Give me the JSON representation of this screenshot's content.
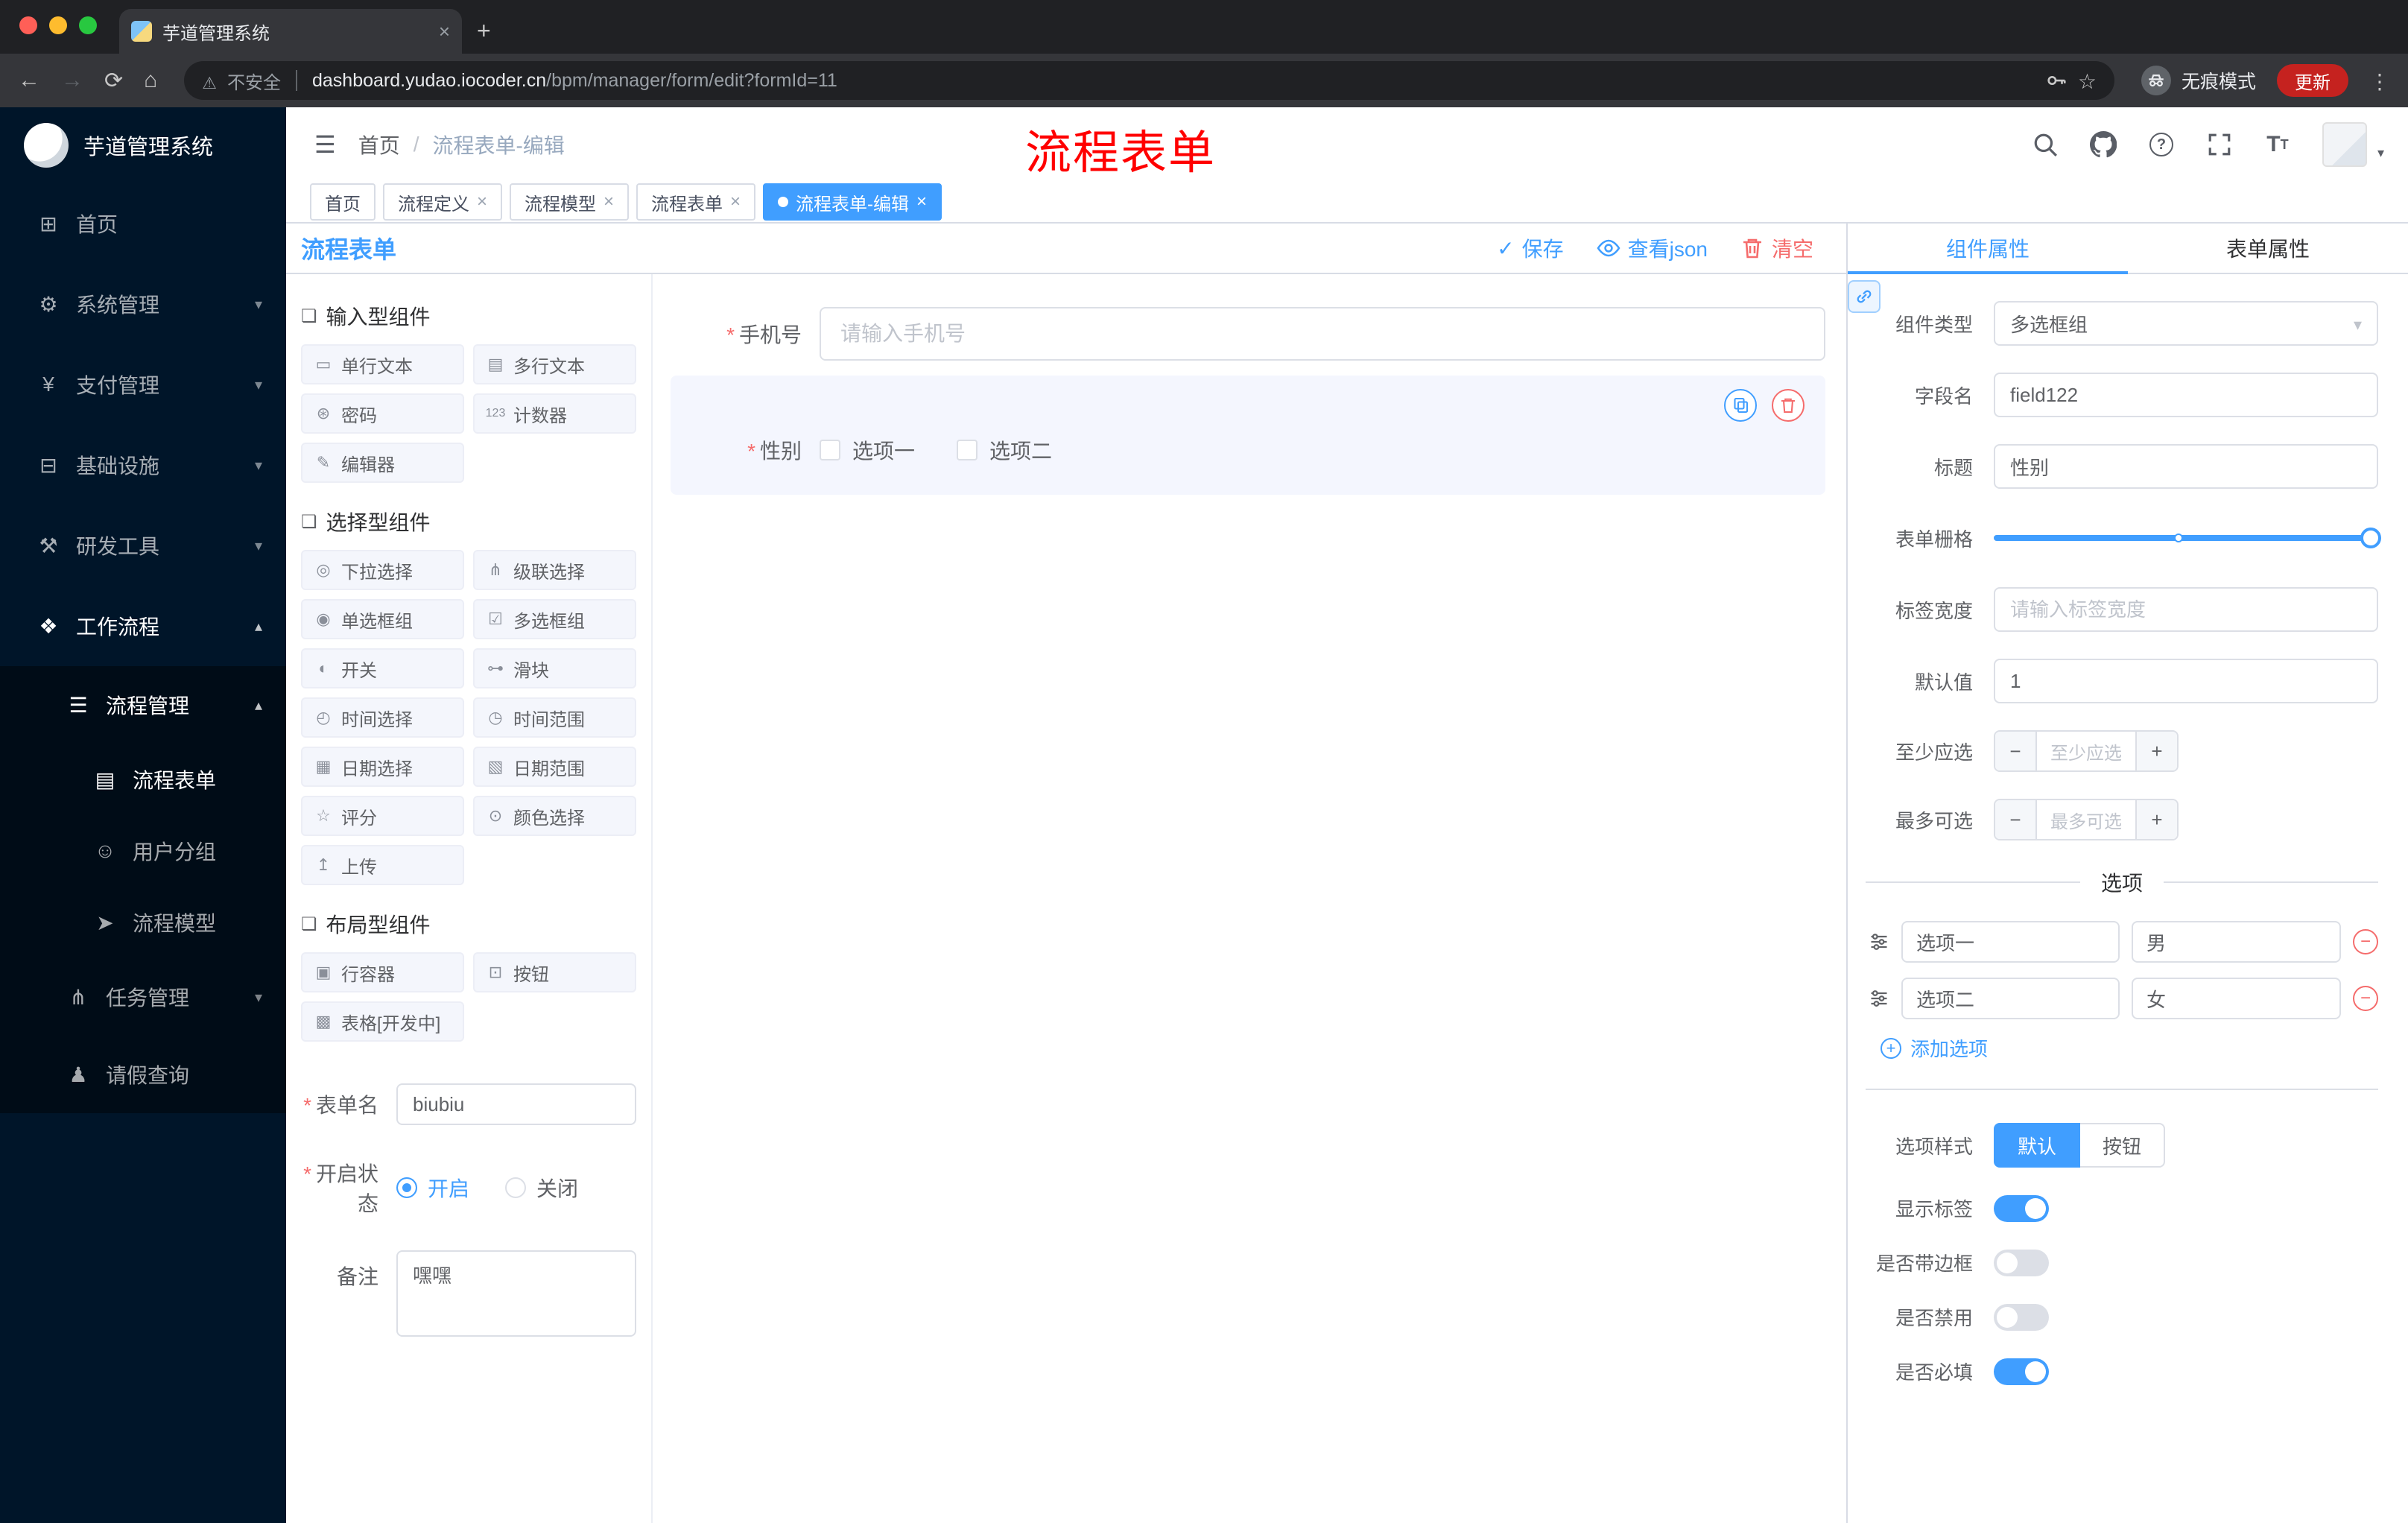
{
  "browser": {
    "tab_title": "芋道管理系统",
    "security_label": "不安全",
    "url_domain": "dashboard.yudao.iocoder.cn",
    "url_path": "/bpm/manager/form/edit?formId=11",
    "incognito_label": "无痕模式",
    "update_label": "更新"
  },
  "sidebar": {
    "brand": "芋道管理系统",
    "items": [
      {
        "icon": "⊞",
        "label": "首页"
      },
      {
        "icon": "⚙",
        "label": "系统管理"
      },
      {
        "icon": "¥",
        "label": "支付管理"
      },
      {
        "icon": "⊟",
        "label": "基础设施"
      },
      {
        "icon": "⚒",
        "label": "研发工具"
      },
      {
        "icon": "❖",
        "label": "工作流程"
      }
    ],
    "workflow": {
      "manage": {
        "icon": "☰",
        "label": "流程管理"
      },
      "children": [
        {
          "icon": "▤",
          "label": "流程表单"
        },
        {
          "icon": "☺",
          "label": "用户分组"
        },
        {
          "icon": "➤",
          "label": "流程模型"
        }
      ],
      "tasks": {
        "icon": "⋔",
        "label": "任务管理"
      },
      "leave": {
        "icon": "♟",
        "label": "请假查询"
      }
    }
  },
  "header": {
    "breadcrumb_home": "首页",
    "breadcrumb_current": "流程表单-编辑",
    "annotation": "流程表单"
  },
  "pagetabs": [
    {
      "label": "首页"
    },
    {
      "label": "流程定义"
    },
    {
      "label": "流程模型"
    },
    {
      "label": "流程表单"
    },
    {
      "label": "流程表单-编辑"
    }
  ],
  "designer": {
    "panel_title": "流程表单",
    "save": "保存",
    "view_json": "查看json",
    "clear": "清空",
    "groups": [
      {
        "icon": "❏",
        "title": "输入型组件",
        "items": [
          {
            "icon": "▭",
            "label": "单行文本"
          },
          {
            "icon": "▤",
            "label": "多行文本"
          },
          {
            "icon": "⊛",
            "label": "密码"
          },
          {
            "icon": "123",
            "label": "计数器"
          },
          {
            "icon": "✎",
            "label": "编辑器"
          }
        ]
      },
      {
        "icon": "❏",
        "title": "选择型组件",
        "items": [
          {
            "icon": "◎",
            "label": "下拉选择"
          },
          {
            "icon": "⋔",
            "label": "级联选择"
          },
          {
            "icon": "◉",
            "label": "单选框组"
          },
          {
            "icon": "☑",
            "label": "多选框组"
          },
          {
            "icon": "◐",
            "label": "开关"
          },
          {
            "icon": "⊶",
            "label": "滑块"
          },
          {
            "icon": "◴",
            "label": "时间选择"
          },
          {
            "icon": "◷",
            "label": "时间范围"
          },
          {
            "icon": "▦",
            "label": "日期选择"
          },
          {
            "icon": "▧",
            "label": "日期范围"
          },
          {
            "icon": "☆",
            "label": "评分"
          },
          {
            "icon": "⊙",
            "label": "颜色选择"
          },
          {
            "icon": "↥",
            "label": "上传"
          }
        ]
      },
      {
        "icon": "❏",
        "title": "布局型组件",
        "items": [
          {
            "icon": "▣",
            "label": "行容器"
          },
          {
            "icon": "⊡",
            "label": "按钮"
          },
          {
            "icon": "▩",
            "label": "表格[开发中]"
          }
        ]
      }
    ],
    "meta": {
      "name_label": "表单名",
      "name_value": "biubiu",
      "status_label": "开启状态",
      "status_on": "开启",
      "status_off": "关闭",
      "remark_label": "备注",
      "remark_value": "嘿嘿"
    },
    "canvas": {
      "phone_label": "手机号",
      "phone_placeholder": "请输入手机号",
      "gender_label": "性别",
      "gender_options": [
        {
          "label": "选项一"
        },
        {
          "label": "选项二"
        }
      ]
    }
  },
  "props": {
    "tab_component": "组件属性",
    "tab_form": "表单属性",
    "type_label": "组件类型",
    "type_value": "多选框组",
    "field_label": "字段名",
    "field_value": "field122",
    "title_label": "标题",
    "title_value": "性别",
    "grid_label": "表单栅格",
    "width_label": "标签宽度",
    "width_placeholder": "请输入标签宽度",
    "default_label": "默认值",
    "default_value": "1",
    "min_label": "至少应选",
    "min_placeholder": "至少应选",
    "max_label": "最多可选",
    "max_placeholder": "最多可选",
    "options_title": "选项",
    "options": [
      {
        "label": "选项一",
        "value": "男"
      },
      {
        "label": "选项二",
        "value": "女"
      }
    ],
    "add_option": "添加选项",
    "style_label": "选项样式",
    "style_default": "默认",
    "style_button": "按钮",
    "show_label_label": "显示标签",
    "border_label": "是否带边框",
    "disabled_label": "是否禁用",
    "required_label": "是否必填"
  }
}
